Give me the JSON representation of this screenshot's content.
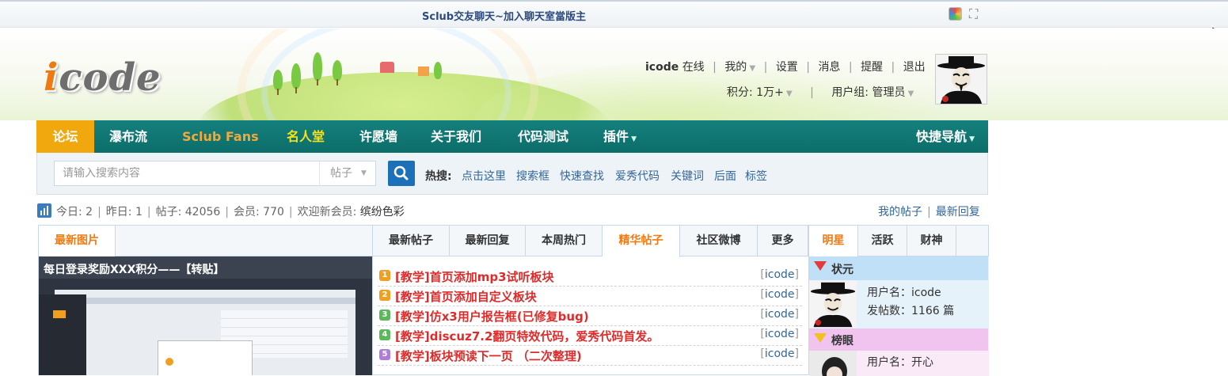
{
  "chat": {
    "title": "Sclub交友聊天~加入聊天室當版主"
  },
  "header": {
    "logo": "icode",
    "user": {
      "name": "icode",
      "online": "在线",
      "my": "我的",
      "settings": "设置",
      "messages": "消息",
      "reminders": "提醒",
      "logout": "退出",
      "points": "积分: 1万+",
      "group": "用户组: 管理员"
    }
  },
  "nav": {
    "items": [
      "论坛",
      "瀑布流",
      "Sclub Fans",
      "名人堂",
      "许愿墙",
      "关于我们",
      "代码测试",
      "插件"
    ],
    "quick": "快捷导航"
  },
  "search": {
    "placeholder": "请输入搜索内容",
    "type": "帖子",
    "hot_label": "热搜:",
    "hot": [
      "点击这里",
      "搜索框",
      "快速查找",
      "爱秀代码",
      "关键词",
      "后面",
      "标签"
    ]
  },
  "stats": {
    "today": "今日: 2",
    "yesterday": "昨日: 1",
    "posts": "帖子: 42056",
    "members": "会员: 770",
    "welcome": "欢迎新会员:",
    "newest": "缤纷色彩",
    "my_posts": "我的帖子",
    "latest_reply": "最新回复"
  },
  "image_panel": {
    "tab": "最新图片",
    "caption": "每日登录奖励XXX积分——【转贴】"
  },
  "posts_panel": {
    "tabs": [
      "最新帖子",
      "最新回复",
      "本周热门",
      "精华帖子",
      "社区微博",
      "更多"
    ],
    "active": "精华帖子",
    "items": [
      {
        "n": "1",
        "title": "[教学]首页添加mp3试听板块",
        "author": "icode",
        "color": "#f0a020"
      },
      {
        "n": "2",
        "title": "[教学]首页添加自定义板块",
        "author": "icode",
        "color": "#f0a020"
      },
      {
        "n": "3",
        "title": "[教学]仿x3用户报告框(已修复bug)",
        "author": "icode",
        "color": "#5cb85c"
      },
      {
        "n": "4",
        "title": "[教学]discuz7.2翻页特效代码，爱秀代码首发。",
        "author": "icode",
        "color": "#5cb85c"
      },
      {
        "n": "5",
        "title": "[教学]板块预读下一页 （二次整理)",
        "author": "icode",
        "color": "#b07cd8"
      }
    ]
  },
  "stars_panel": {
    "tabs": [
      "明星",
      "活跃",
      "财神"
    ],
    "first": {
      "rank": "状元",
      "username": "用户名：icode",
      "posts": "发帖数：1166 篇"
    },
    "second": {
      "rank": "榜眼",
      "username": "用户名：开心"
    }
  }
}
